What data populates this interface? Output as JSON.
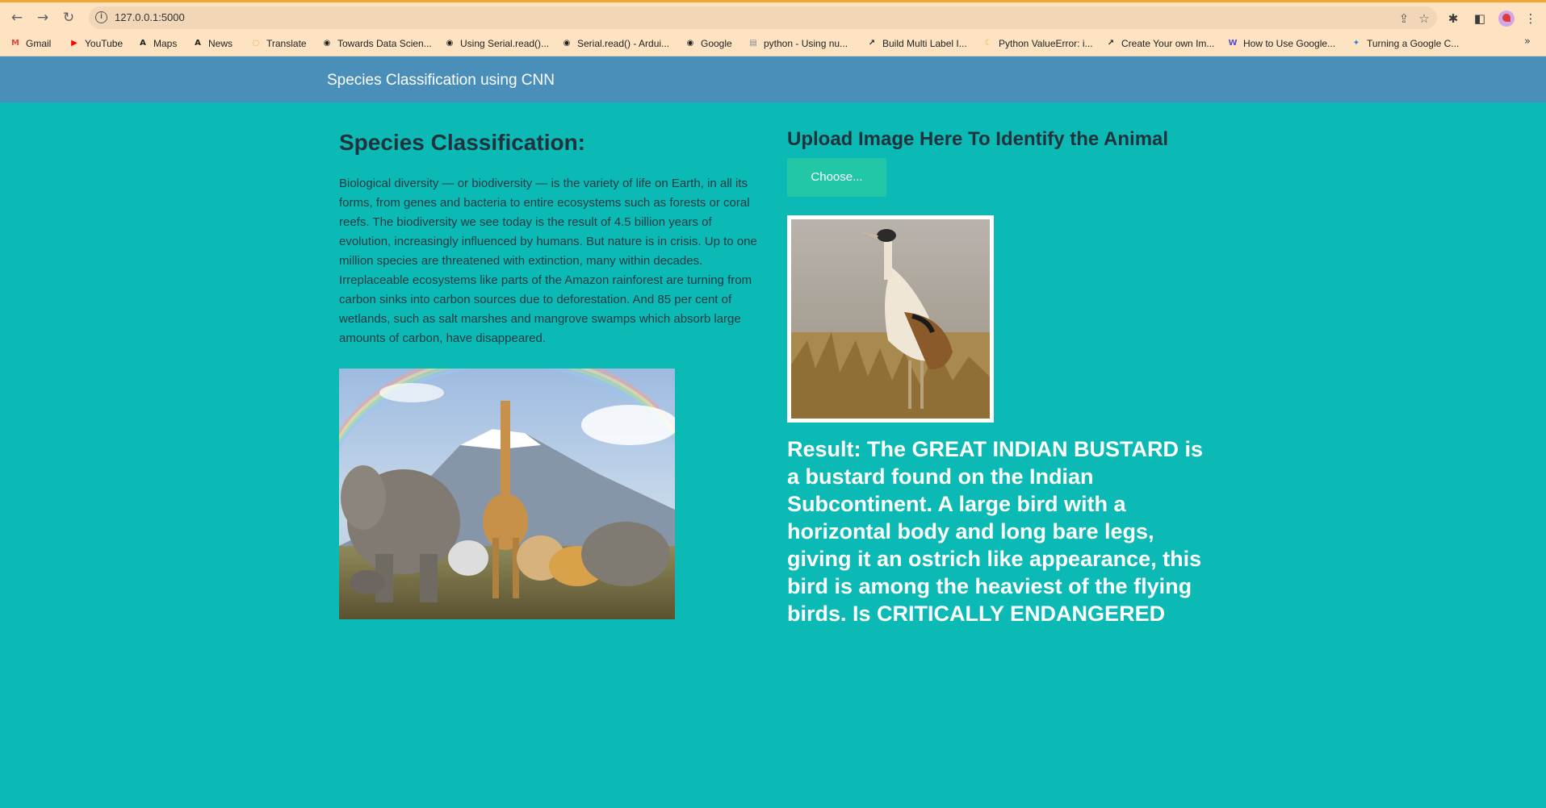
{
  "browser": {
    "url": "127.0.0.1:5000",
    "bookmarks": [
      {
        "label": "Gmail",
        "icon": "gmail-icon",
        "color": "#ea4335"
      },
      {
        "label": "YouTube",
        "icon": "youtube-icon",
        "color": "#ff0000"
      },
      {
        "label": "Maps",
        "icon": "maps-icon",
        "color": "#222222"
      },
      {
        "label": "News",
        "icon": "news-icon",
        "color": "#222222"
      },
      {
        "label": "Translate",
        "icon": "translate-icon",
        "color": "#f28b1a"
      },
      {
        "label": "Towards Data Scien...",
        "icon": "globe-icon",
        "color": "#222222"
      },
      {
        "label": "Using Serial.read()...",
        "icon": "globe-icon",
        "color": "#222222"
      },
      {
        "label": "Serial.read() - Ardui...",
        "icon": "globe-icon",
        "color": "#222222"
      },
      {
        "label": "Google",
        "icon": "globe-icon",
        "color": "#222222"
      },
      {
        "label": "python - Using nu...",
        "icon": "stackoverflow-icon",
        "color": "#7b8a95"
      },
      {
        "label": "Build Multi Label I...",
        "icon": "chart-icon",
        "color": "#222222"
      },
      {
        "label": "Python ValueError: i...",
        "icon": "moon-icon",
        "color": "#f2b31a"
      },
      {
        "label": "Create Your own Im...",
        "icon": "chart-icon",
        "color": "#222222"
      },
      {
        "label": "How to Use Google...",
        "icon": "wm-icon",
        "color": "#5b4fd1"
      },
      {
        "label": "Turning a Google C...",
        "icon": "compass-icon",
        "color": "#1e88e5"
      }
    ]
  },
  "navbar": {
    "brand": "Species Classification using CNN"
  },
  "main": {
    "title": "Species Classification:",
    "description": "Biological diversity — or biodiversity — is the variety of life on Earth, in all its forms, from genes and bacteria to entire ecosystems such as forests or coral reefs. The biodiversity we see today is the result of 4.5 billion years of evolution, increasingly influenced by humans. But nature is in crisis. Up to one million species are threatened with extinction, many within decades. Irreplaceable ecosystems like parts of the Amazon rainforest are turning from carbon sinks into carbon sources due to deforestation. And 85 per cent of wetlands, such as salt marshes and mangrove swamps which absorb large amounts of carbon, have disappeared.",
    "upload_heading": "Upload Image Here To Identify the Animal",
    "choose_label": "Choose...",
    "result": "Result: The GREAT INDIAN BUSTARD is a bustard found on the Indian Subcontinent. A large bird with a horizontal body and long bare legs, giving it an ostrich like appearance, this bird is among the heaviest of the flying birds. Is CRITICALLY ENDANGERED"
  },
  "colors": {
    "page_bg": "#0bbab5",
    "navbar_bg": "#4a8fba",
    "button_bg": "#22c7a8",
    "browser_bg": "#fde3c2"
  }
}
